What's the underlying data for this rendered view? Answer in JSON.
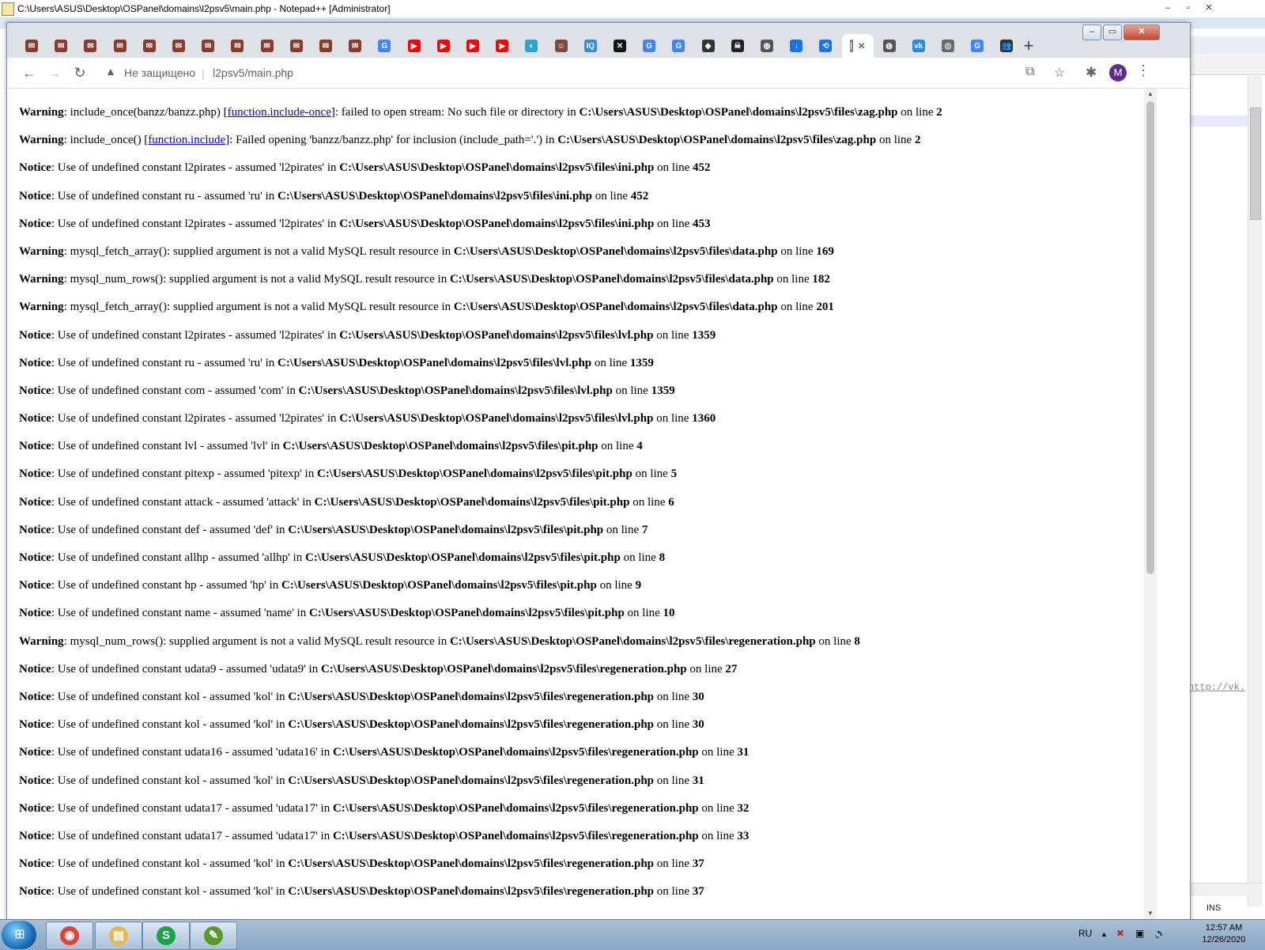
{
  "npp": {
    "title": "C:\\Users\\ASUS\\Desktop\\OSPanel\\domains\\l2psv5\\main.php - Notepad++ [Administrator]",
    "min": "‒",
    "max": "▫",
    "close": "✕",
    "url_fragment": "http://vk.",
    "status_ins": "INS"
  },
  "browser": {
    "tab_close_glyph": "✕",
    "new_tab_glyph": "+",
    "window": {
      "min": "–",
      "max": "▭",
      "close": "✕"
    },
    "omnibox": {
      "security_label": "Не защищено",
      "url": "l2psv5/main.php"
    },
    "profile_initial": "M"
  },
  "tabs": [
    {
      "icon": "mail-icon",
      "glyph": "✉",
      "color": "#8a3b2b"
    },
    {
      "icon": "mail-icon",
      "glyph": "✉",
      "color": "#8a3b2b"
    },
    {
      "icon": "mail-icon",
      "glyph": "✉",
      "color": "#8a3b2b"
    },
    {
      "icon": "mail-icon",
      "glyph": "✉",
      "color": "#8a3b2b"
    },
    {
      "icon": "mail-icon",
      "glyph": "✉",
      "color": "#8a3b2b"
    },
    {
      "icon": "mail-icon",
      "glyph": "✉",
      "color": "#8a3b2b"
    },
    {
      "icon": "mail-icon",
      "glyph": "✉",
      "color": "#8a3b2b"
    },
    {
      "icon": "mail-icon",
      "glyph": "✉",
      "color": "#8a3b2b"
    },
    {
      "icon": "mail-icon",
      "glyph": "✉",
      "color": "#8a3b2b"
    },
    {
      "icon": "mail-icon",
      "glyph": "✉",
      "color": "#8a3b2b"
    },
    {
      "icon": "mail-icon",
      "glyph": "✉",
      "color": "#8a3b2b"
    },
    {
      "icon": "mail-icon",
      "glyph": "✉",
      "color": "#8a3b2b"
    },
    {
      "icon": "google-icon",
      "glyph": "G",
      "color": "#4285f4"
    },
    {
      "icon": "youtube-icon",
      "glyph": "▶",
      "color": "#ff0000"
    },
    {
      "icon": "youtube-icon",
      "glyph": "▶",
      "color": "#ff0000"
    },
    {
      "icon": "youtube-icon",
      "glyph": "▶",
      "color": "#ff0000"
    },
    {
      "icon": "youtube-icon",
      "glyph": "▶",
      "color": "#ff0000"
    },
    {
      "icon": "site-icon",
      "glyph": "◐",
      "color": "#2aa6c9"
    },
    {
      "icon": "avatar-icon",
      "glyph": "☺",
      "color": "#7a4a3a"
    },
    {
      "icon": "iq-icon",
      "glyph": "IQ",
      "color": "#2e8fd6"
    },
    {
      "icon": "x-icon",
      "glyph": "✕",
      "color": "#111111"
    },
    {
      "icon": "google-icon",
      "glyph": "G",
      "color": "#4285f4"
    },
    {
      "icon": "google-icon",
      "glyph": "G",
      "color": "#4285f4"
    },
    {
      "icon": "shield-icon",
      "glyph": "◆",
      "color": "#333333"
    },
    {
      "icon": "pirate-icon",
      "glyph": "☠",
      "color": "#222222"
    },
    {
      "icon": "globe-icon",
      "glyph": "◍",
      "color": "#555555"
    },
    {
      "icon": "download-icon",
      "glyph": "↓",
      "color": "#1a73e8"
    },
    {
      "icon": "history-icon",
      "glyph": "⟲",
      "color": "#1a73e8"
    },
    {
      "icon": "active-page-icon",
      "glyph": "|",
      "color": "#777777",
      "active": true
    },
    {
      "icon": "globe-icon",
      "glyph": "◍",
      "color": "#555555"
    },
    {
      "icon": "vk-icon",
      "glyph": "vk",
      "color": "#2787f5"
    },
    {
      "icon": "podcast-icon",
      "glyph": "◎",
      "color": "#6a6a6a"
    },
    {
      "icon": "google-icon",
      "glyph": "G",
      "color": "#4285f4"
    },
    {
      "icon": "group-icon",
      "glyph": "👥",
      "color": "#333333"
    }
  ],
  "errors": [
    {
      "type": "Warning",
      "parts": [
        ": include_once(banzz/banzz.php) [",
        {
          "link": "function.include-once"
        },
        "]: failed to open stream: No such file or directory in "
      ],
      "path": "C:\\Users\\ASUS\\Desktop\\OSPanel\\domains\\l2psv5\\files\\zag.php",
      "line": "2"
    },
    {
      "type": "Warning",
      "parts": [
        ": include_once() [",
        {
          "link": "function.include"
        },
        "]: Failed opening 'banzz/banzz.php' for inclusion (include_path='.') in "
      ],
      "path": "C:\\Users\\ASUS\\Desktop\\OSPanel\\domains\\l2psv5\\files\\zag.php",
      "line": "2"
    },
    {
      "type": "Notice",
      "parts": [
        ": Use of undefined constant l2pirates - assumed 'l2pirates' in "
      ],
      "path": "C:\\Users\\ASUS\\Desktop\\OSPanel\\domains\\l2psv5\\files\\ini.php",
      "line": "452"
    },
    {
      "type": "Notice",
      "parts": [
        ": Use of undefined constant ru - assumed 'ru' in "
      ],
      "path": "C:\\Users\\ASUS\\Desktop\\OSPanel\\domains\\l2psv5\\files\\ini.php",
      "line": "452"
    },
    {
      "type": "Notice",
      "parts": [
        ": Use of undefined constant l2pirates - assumed 'l2pirates' in "
      ],
      "path": "C:\\Users\\ASUS\\Desktop\\OSPanel\\domains\\l2psv5\\files\\ini.php",
      "line": "453"
    },
    {
      "type": "Warning",
      "parts": [
        ": mysql_fetch_array(): supplied argument is not a valid MySQL result resource in "
      ],
      "path": "C:\\Users\\ASUS\\Desktop\\OSPanel\\domains\\l2psv5\\files\\data.php",
      "line": "169"
    },
    {
      "type": "Warning",
      "parts": [
        ": mysql_num_rows(): supplied argument is not a valid MySQL result resource in "
      ],
      "path": "C:\\Users\\ASUS\\Desktop\\OSPanel\\domains\\l2psv5\\files\\data.php",
      "line": "182"
    },
    {
      "type": "Warning",
      "parts": [
        ": mysql_fetch_array(): supplied argument is not a valid MySQL result resource in "
      ],
      "path": "C:\\Users\\ASUS\\Desktop\\OSPanel\\domains\\l2psv5\\files\\data.php",
      "line": "201"
    },
    {
      "type": "Notice",
      "parts": [
        ": Use of undefined constant l2pirates - assumed 'l2pirates' in "
      ],
      "path": "C:\\Users\\ASUS\\Desktop\\OSPanel\\domains\\l2psv5\\files\\lvl.php",
      "line": "1359"
    },
    {
      "type": "Notice",
      "parts": [
        ": Use of undefined constant ru - assumed 'ru' in "
      ],
      "path": "C:\\Users\\ASUS\\Desktop\\OSPanel\\domains\\l2psv5\\files\\lvl.php",
      "line": "1359"
    },
    {
      "type": "Notice",
      "parts": [
        ": Use of undefined constant com - assumed 'com' in "
      ],
      "path": "C:\\Users\\ASUS\\Desktop\\OSPanel\\domains\\l2psv5\\files\\lvl.php",
      "line": "1359"
    },
    {
      "type": "Notice",
      "parts": [
        ": Use of undefined constant l2pirates - assumed 'l2pirates' in "
      ],
      "path": "C:\\Users\\ASUS\\Desktop\\OSPanel\\domains\\l2psv5\\files\\lvl.php",
      "line": "1360"
    },
    {
      "type": "Notice",
      "parts": [
        ": Use of undefined constant lvl - assumed 'lvl' in "
      ],
      "path": "C:\\Users\\ASUS\\Desktop\\OSPanel\\domains\\l2psv5\\files\\pit.php",
      "line": "4"
    },
    {
      "type": "Notice",
      "parts": [
        ": Use of undefined constant pitexp - assumed 'pitexp' in "
      ],
      "path": "C:\\Users\\ASUS\\Desktop\\OSPanel\\domains\\l2psv5\\files\\pit.php",
      "line": "5"
    },
    {
      "type": "Notice",
      "parts": [
        ": Use of undefined constant attack - assumed 'attack' in "
      ],
      "path": "C:\\Users\\ASUS\\Desktop\\OSPanel\\domains\\l2psv5\\files\\pit.php",
      "line": "6"
    },
    {
      "type": "Notice",
      "parts": [
        ": Use of undefined constant def - assumed 'def' in "
      ],
      "path": "C:\\Users\\ASUS\\Desktop\\OSPanel\\domains\\l2psv5\\files\\pit.php",
      "line": "7"
    },
    {
      "type": "Notice",
      "parts": [
        ": Use of undefined constant allhp - assumed 'allhp' in "
      ],
      "path": "C:\\Users\\ASUS\\Desktop\\OSPanel\\domains\\l2psv5\\files\\pit.php",
      "line": "8"
    },
    {
      "type": "Notice",
      "parts": [
        ": Use of undefined constant hp - assumed 'hp' in "
      ],
      "path": "C:\\Users\\ASUS\\Desktop\\OSPanel\\domains\\l2psv5\\files\\pit.php",
      "line": "9"
    },
    {
      "type": "Notice",
      "parts": [
        ": Use of undefined constant name - assumed 'name' in "
      ],
      "path": "C:\\Users\\ASUS\\Desktop\\OSPanel\\domains\\l2psv5\\files\\pit.php",
      "line": "10"
    },
    {
      "type": "Warning",
      "parts": [
        ": mysql_num_rows(): supplied argument is not a valid MySQL result resource in "
      ],
      "path": "C:\\Users\\ASUS\\Desktop\\OSPanel\\domains\\l2psv5\\files\\regeneration.php",
      "line": "8"
    },
    {
      "type": "Notice",
      "parts": [
        ": Use of undefined constant udata9 - assumed 'udata9' in "
      ],
      "path": "C:\\Users\\ASUS\\Desktop\\OSPanel\\domains\\l2psv5\\files\\regeneration.php",
      "line": "27"
    },
    {
      "type": "Notice",
      "parts": [
        ": Use of undefined constant kol - assumed 'kol' in "
      ],
      "path": "C:\\Users\\ASUS\\Desktop\\OSPanel\\domains\\l2psv5\\files\\regeneration.php",
      "line": "30"
    },
    {
      "type": "Notice",
      "parts": [
        ": Use of undefined constant kol - assumed 'kol' in "
      ],
      "path": "C:\\Users\\ASUS\\Desktop\\OSPanel\\domains\\l2psv5\\files\\regeneration.php",
      "line": "30"
    },
    {
      "type": "Notice",
      "parts": [
        ": Use of undefined constant udata16 - assumed 'udata16' in "
      ],
      "path": "C:\\Users\\ASUS\\Desktop\\OSPanel\\domains\\l2psv5\\files\\regeneration.php",
      "line": "31"
    },
    {
      "type": "Notice",
      "parts": [
        ": Use of undefined constant kol - assumed 'kol' in "
      ],
      "path": "C:\\Users\\ASUS\\Desktop\\OSPanel\\domains\\l2psv5\\files\\regeneration.php",
      "line": "31"
    },
    {
      "type": "Notice",
      "parts": [
        ": Use of undefined constant udata17 - assumed 'udata17' in "
      ],
      "path": "C:\\Users\\ASUS\\Desktop\\OSPanel\\domains\\l2psv5\\files\\regeneration.php",
      "line": "32"
    },
    {
      "type": "Notice",
      "parts": [
        ": Use of undefined constant udata17 - assumed 'udata17' in "
      ],
      "path": "C:\\Users\\ASUS\\Desktop\\OSPanel\\domains\\l2psv5\\files\\regeneration.php",
      "line": "33"
    },
    {
      "type": "Notice",
      "parts": [
        ": Use of undefined constant kol - assumed 'kol' in "
      ],
      "path": "C:\\Users\\ASUS\\Desktop\\OSPanel\\domains\\l2psv5\\files\\regeneration.php",
      "line": "37"
    },
    {
      "type": "Notice",
      "parts": [
        ": Use of undefined constant kol - assumed 'kol' in "
      ],
      "path": "C:\\Users\\ASUS\\Desktop\\OSPanel\\domains\\l2psv5\\files\\regeneration.php",
      "line": "37"
    }
  ],
  "on_line_label": " on line ",
  "taskbar": {
    "apps": [
      {
        "name": "chrome-taskbar-button",
        "icon": "chrome-icon",
        "glyph": "◉",
        "color": "#db4437"
      },
      {
        "name": "explorer-taskbar-button",
        "icon": "folder-icon",
        "glyph": "▤",
        "color": "#e8b84a"
      },
      {
        "name": "skype-taskbar-button",
        "icon": "s-app-icon",
        "glyph": "S",
        "color": "#1aa34a"
      },
      {
        "name": "notepadpp-taskbar-button",
        "icon": "notepadpp-icon",
        "glyph": "✎",
        "color": "#5a9a2a"
      }
    ],
    "language": "RU",
    "time": "12:57 AM",
    "date": "12/26/2020"
  }
}
